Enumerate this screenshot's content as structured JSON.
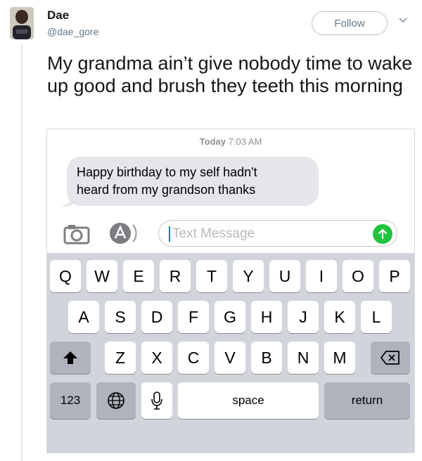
{
  "tweet": {
    "author_name": "Dae",
    "author_handle": "@dae_gore",
    "follow_label": "Follow",
    "text": "My grandma ain’t give nobody time to wake up good and brush they teeth this morning"
  },
  "icons": {
    "avatar": "avatar-photo",
    "caret": "chevron-down-icon",
    "camera": "camera-icon",
    "app_store": "app-store-icon",
    "send": "send-arrow-icon",
    "shift": "shift-icon",
    "backspace": "backspace-icon",
    "globe": "globe-icon",
    "mic": "microphone-icon"
  },
  "colors": {
    "send_button": "#1fc43f",
    "bubble": "#e5e5ea",
    "keyboard_bg": "#d1d5db"
  },
  "messages": {
    "timestamp_day": "Today",
    "timestamp_time": "7:03 AM",
    "bubble_line1": "Happy birthday to  my self  hadn't",
    "bubble_line2": "heard from my grandson  thanks",
    "input_placeholder": "Text Message"
  },
  "keyboard": {
    "row1": [
      "Q",
      "W",
      "E",
      "R",
      "T",
      "Y",
      "U",
      "I",
      "O",
      "P"
    ],
    "row2": [
      "A",
      "S",
      "D",
      "F",
      "G",
      "H",
      "J",
      "K",
      "L"
    ],
    "row3": [
      "Z",
      "X",
      "C",
      "V",
      "B",
      "N",
      "M"
    ],
    "numbers_label": "123",
    "space_label": "space",
    "return_label": "return"
  }
}
